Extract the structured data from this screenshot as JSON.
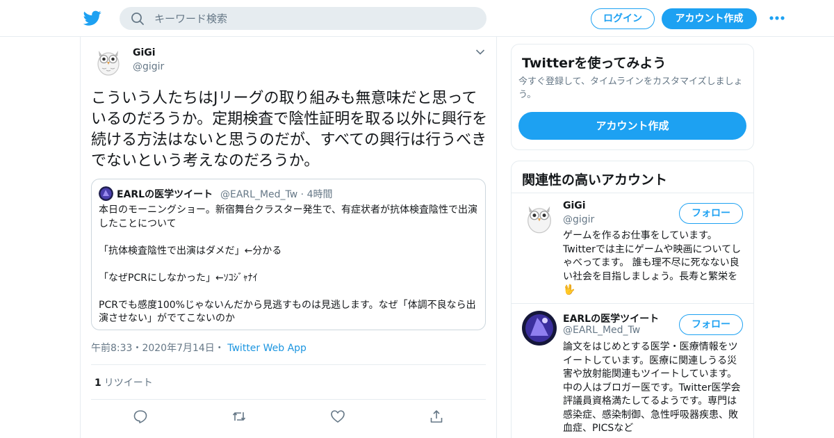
{
  "header": {
    "search_placeholder": "キーワード検索",
    "login_label": "ログイン",
    "signup_label": "アカウント作成"
  },
  "tweet": {
    "author_name": "GiGi",
    "author_handle": "@gigir",
    "text": "こういう人たちはJリーグの取り組みも無意味だと思っているのだろうか。定期検査で陰性証明を取る以外に興行を続ける方法はないと思うのだが、すべての興行は行うべきでないという考えなのだろうか。",
    "quote": {
      "name": "EARLの医学ツイート",
      "handle": "@EARL_Med_Tw",
      "time": "· 4時間",
      "text": "本日のモーニングショー。新宿舞台クラスター発生で、有症状者が抗体検査陰性で出演したことについて\n\n「抗体検査陰性で出演はダメだ」←分かる\n\n「なぜPCRにしなかった」←ｿｺｼﾞｬﾅｲ\n\nPCRでも感度100%じゃないんだから見逃すものは見逃します。なぜ「体調不良なら出演させない」がでてこないのか"
    },
    "timestamp": "午前8:33・2020年7月14日・",
    "via": "Twitter Web App",
    "retweet_count": "1",
    "retweet_label": "リツイート"
  },
  "sidebar": {
    "signup_card": {
      "title": "Twitterを使ってみよう",
      "desc": "今すぐ登録して、タイムラインをカスタマイズしましょう。",
      "button": "アカウント作成"
    },
    "related": {
      "title": "関連性の高いアカウント",
      "follow_label": "フォロー",
      "accounts": [
        {
          "name": "GiGi",
          "handle": "@gigir",
          "bio": "ゲームを作るお仕事をしています。Twitterでは主にゲームや映画についてしゃべってます。 誰も理不尽に死なない良い社会を目指しましょう。長寿と繁栄を🖖"
        },
        {
          "name": "EARLの医学ツイート",
          "handle": "@EARL_Med_Tw",
          "bio": "論文をはじめとする医学・医療情報をツイートしています。医療に関連しうる災害や放射能関連もツイートしています。中の人はブロガー医です。Twitter医学会評議員資格満たしてるようです。専門は感染症、感染制御、急性呼吸器疾患、敗血症、PICSなど"
        }
      ]
    }
  },
  "colors": {
    "accent": "#1da1f2",
    "secondary_text": "#657786",
    "border": "#e6ecf0"
  }
}
